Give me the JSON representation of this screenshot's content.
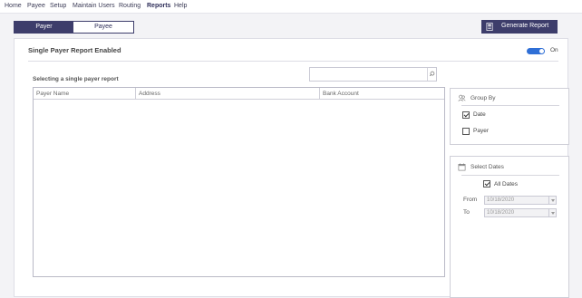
{
  "menu": {
    "items": [
      {
        "label": "Home"
      },
      {
        "label": "Payee"
      },
      {
        "label": "Setup"
      },
      {
        "label": "Maintain Users"
      },
      {
        "label": "Routing"
      },
      {
        "label": "Reports"
      },
      {
        "label": "Help"
      }
    ],
    "active": "Reports"
  },
  "toggle": {
    "options": [
      "Payer",
      "Payee"
    ],
    "selected": "Payer"
  },
  "generate_button": {
    "label": "Generate Report",
    "icon": "report-icon"
  },
  "report": {
    "title": "Single Payer Report Enabled",
    "switch_label": "On",
    "switch_on": true,
    "subtitle": "Selecting a single payer report",
    "search": {
      "value": "",
      "icon": "search-icon"
    },
    "columns": [
      "Payer Name",
      "Address",
      "Bank Account"
    ]
  },
  "group_by": {
    "title": "Group By",
    "icon": "group-icon",
    "options": [
      {
        "label": "Date",
        "checked": true
      },
      {
        "label": "Payer",
        "checked": false
      }
    ]
  },
  "select_dates": {
    "title": "Select Dates",
    "icon": "calendar-icon",
    "all_dates": {
      "label": "All Dates",
      "checked": true
    },
    "from_label": "From",
    "from_value": "10/18/2020",
    "to_label": "To",
    "to_value": "10/18/2020"
  },
  "colors": {
    "brand": "#3d3d6b",
    "switch": "#2f6fd6"
  }
}
